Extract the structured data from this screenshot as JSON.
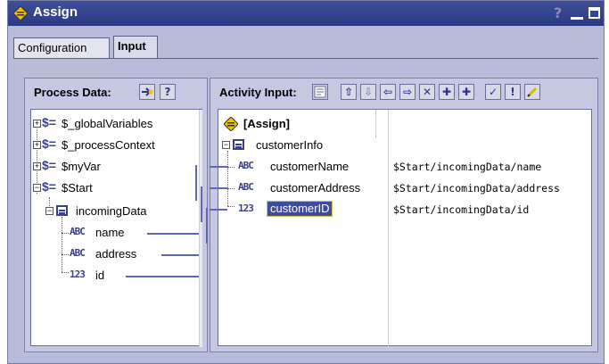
{
  "window": {
    "title": "Assign",
    "help_glyph": "?"
  },
  "tabs": [
    {
      "label": "Configuration",
      "active": false
    },
    {
      "label": "Input",
      "active": true
    }
  ],
  "process_data": {
    "label": "Process Data:",
    "tree": [
      {
        "label": "$_globalVariables",
        "expanded": false
      },
      {
        "label": "$_processContext",
        "expanded": false
      },
      {
        "label": "$myVar",
        "expanded": false
      },
      {
        "label": "$Start",
        "expanded": true
      },
      {
        "label": "incomingData",
        "expanded": true
      },
      {
        "label": "name",
        "type": "ABC"
      },
      {
        "label": "address",
        "type": "ABC"
      },
      {
        "label": "id",
        "type": "123"
      }
    ]
  },
  "activity_input": {
    "label": "Activity Input:",
    "root": "[Assign]",
    "group": "customerInfo",
    "fields": [
      {
        "label": "customerName",
        "type": "ABC",
        "mapping": "$Start/incomingData/name"
      },
      {
        "label": "customerAddress",
        "type": "ABC",
        "mapping": "$Start/incomingData/address"
      },
      {
        "label": "customerID",
        "type": "123",
        "mapping": "$Start/incomingData/id",
        "selected": true
      }
    ]
  },
  "type_glyphs": {
    "string": "ABC",
    "number": "123"
  },
  "colors": {
    "titlebar": "#2c3a84",
    "panel": "#c5c8e0",
    "link": "#6066b0",
    "selection": "#3e4c9b"
  }
}
